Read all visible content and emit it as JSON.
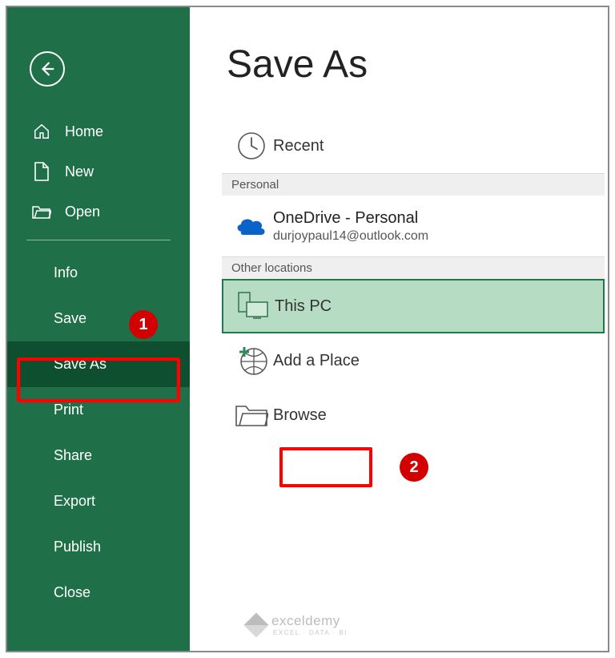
{
  "sidebar": {
    "nav": [
      {
        "label": "Home"
      },
      {
        "label": "New"
      },
      {
        "label": "Open"
      }
    ],
    "sub": [
      {
        "label": "Info"
      },
      {
        "label": "Save"
      },
      {
        "label": "Save As"
      },
      {
        "label": "Print"
      },
      {
        "label": "Share"
      },
      {
        "label": "Export"
      },
      {
        "label": "Publish"
      },
      {
        "label": "Close"
      }
    ]
  },
  "page": {
    "title": "Save As",
    "sections": {
      "personal": "Personal",
      "other": "Other locations"
    },
    "recent": "Recent",
    "onedrive": {
      "title": "OneDrive - Personal",
      "email": "durjoypaul14@outlook.com"
    },
    "thispc": "This PC",
    "addplace": "Add a Place",
    "browse": "Browse"
  },
  "callouts": {
    "one": "1",
    "two": "2"
  },
  "watermark": {
    "brand": "exceldemy",
    "tag": "EXCEL · DATA · BI"
  }
}
